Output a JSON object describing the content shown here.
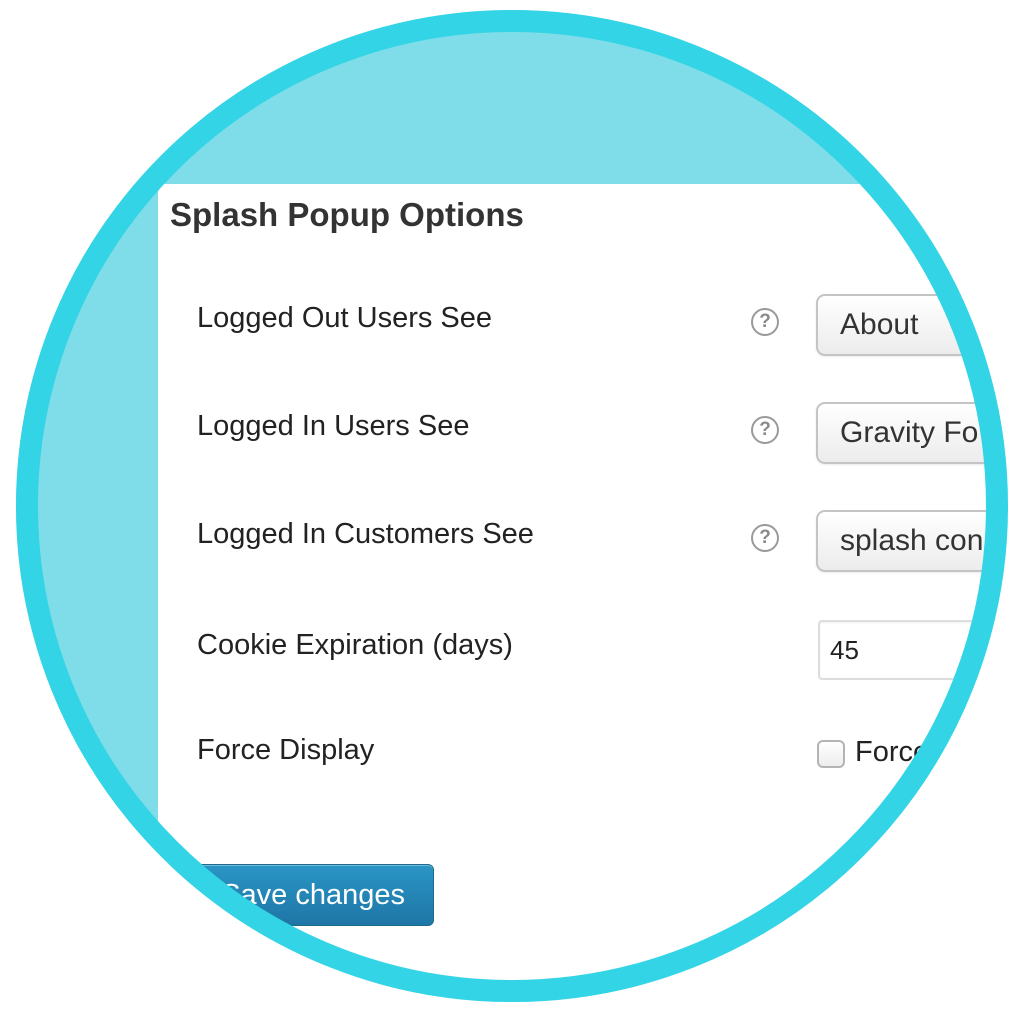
{
  "panel": {
    "title": "Splash Popup Options"
  },
  "rows": [
    {
      "label": "Logged Out Users See",
      "help_icon": "question-circle-icon",
      "selected": "About"
    },
    {
      "label": "Logged In Users See",
      "help_icon": "question-circle-icon",
      "selected": "Gravity Fo"
    },
    {
      "label": "Logged In Customers See",
      "help_icon": "question-circle-icon",
      "selected": "splash con"
    }
  ],
  "cookie": {
    "label": "Cookie Expiration (days)",
    "value": "45"
  },
  "force_display": {
    "label": "Force Display",
    "checkbox_label": "Force",
    "checked": false
  },
  "save_button": {
    "label": "Save changes"
  },
  "help_glyph": "?",
  "colors": {
    "ring": "#33d4e6",
    "background": "#7fdde9",
    "primary_button": "#2a95c5"
  }
}
